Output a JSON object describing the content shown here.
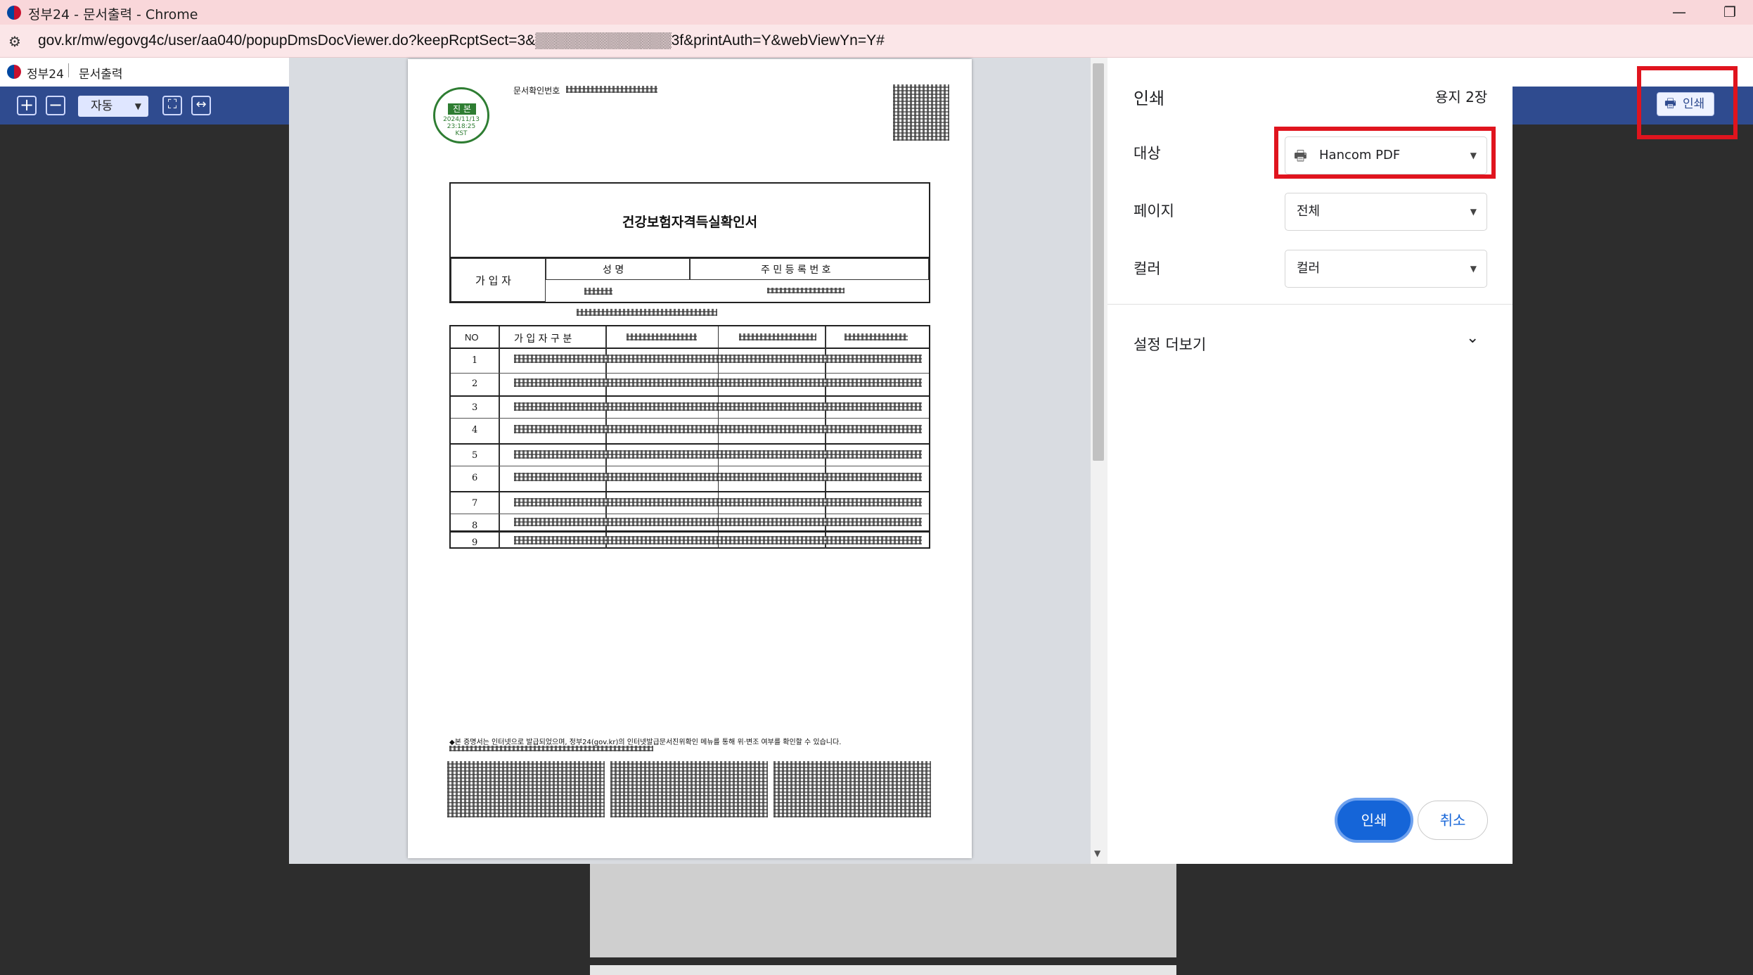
{
  "window": {
    "title": "정부24 - 문서출력 - Chrome",
    "minimize_glyph": "—",
    "restore_glyph": "❐"
  },
  "address_bar": {
    "url": "gov.kr/mw/egovg4c/user/aa040/popupDmsDocViewer.do?keepRcptSect=3&▒▒▒▒▒▒▒▒▒▒▒▒▒3f&printAuth=Y&webViewYn=Y#"
  },
  "app_header": {
    "site_name": "정부24",
    "page_name": "문서출력"
  },
  "toolbar": {
    "zoom_in_glyph": "+",
    "zoom_out_glyph": "−",
    "zoom_select_value": "자동",
    "fit_page_glyph": "⛶",
    "fit_width_glyph": "↔",
    "print_label": "인쇄"
  },
  "document": {
    "doc_check_label": "문서확인번호",
    "stamp_top": "진 본",
    "stamp_date": "2024/11/13",
    "stamp_time": "23:18:25",
    "stamp_tz": "KST",
    "title": "건강보험자격득실확인서",
    "subscriber_label": "가 입 자",
    "name_header": "성 명",
    "rrn_header": "주 민 등 록 번 호",
    "no_header": "NO",
    "col2_header": "가 입 자 구 분",
    "row_numbers": [
      "1",
      "2",
      "3",
      "4",
      "5",
      "6",
      "7",
      "8",
      "9"
    ],
    "footer_note": "◆본 증명서는 인터넷으로 발급되었으며, 정부24(gov.kr)의 인터넷발급문서진위확인 메뉴를 통해 위·변조 여부를 확인할 수 있습니다."
  },
  "print_panel": {
    "title": "인쇄",
    "sheet_count_prefix": "용지",
    "sheet_count_value": "2장",
    "destination_label": "대상",
    "destination_value": "Hancom PDF",
    "pages_label": "페이지",
    "pages_value": "전체",
    "color_label": "컬러",
    "color_value": "컬러",
    "more_settings_label": "설정 더보기",
    "print_button": "인쇄",
    "cancel_button": "취소"
  },
  "colors": {
    "toolbar_blue": "#2f4b8f",
    "highlight_red": "#e0141e",
    "print_button_blue": "#1565d8"
  }
}
